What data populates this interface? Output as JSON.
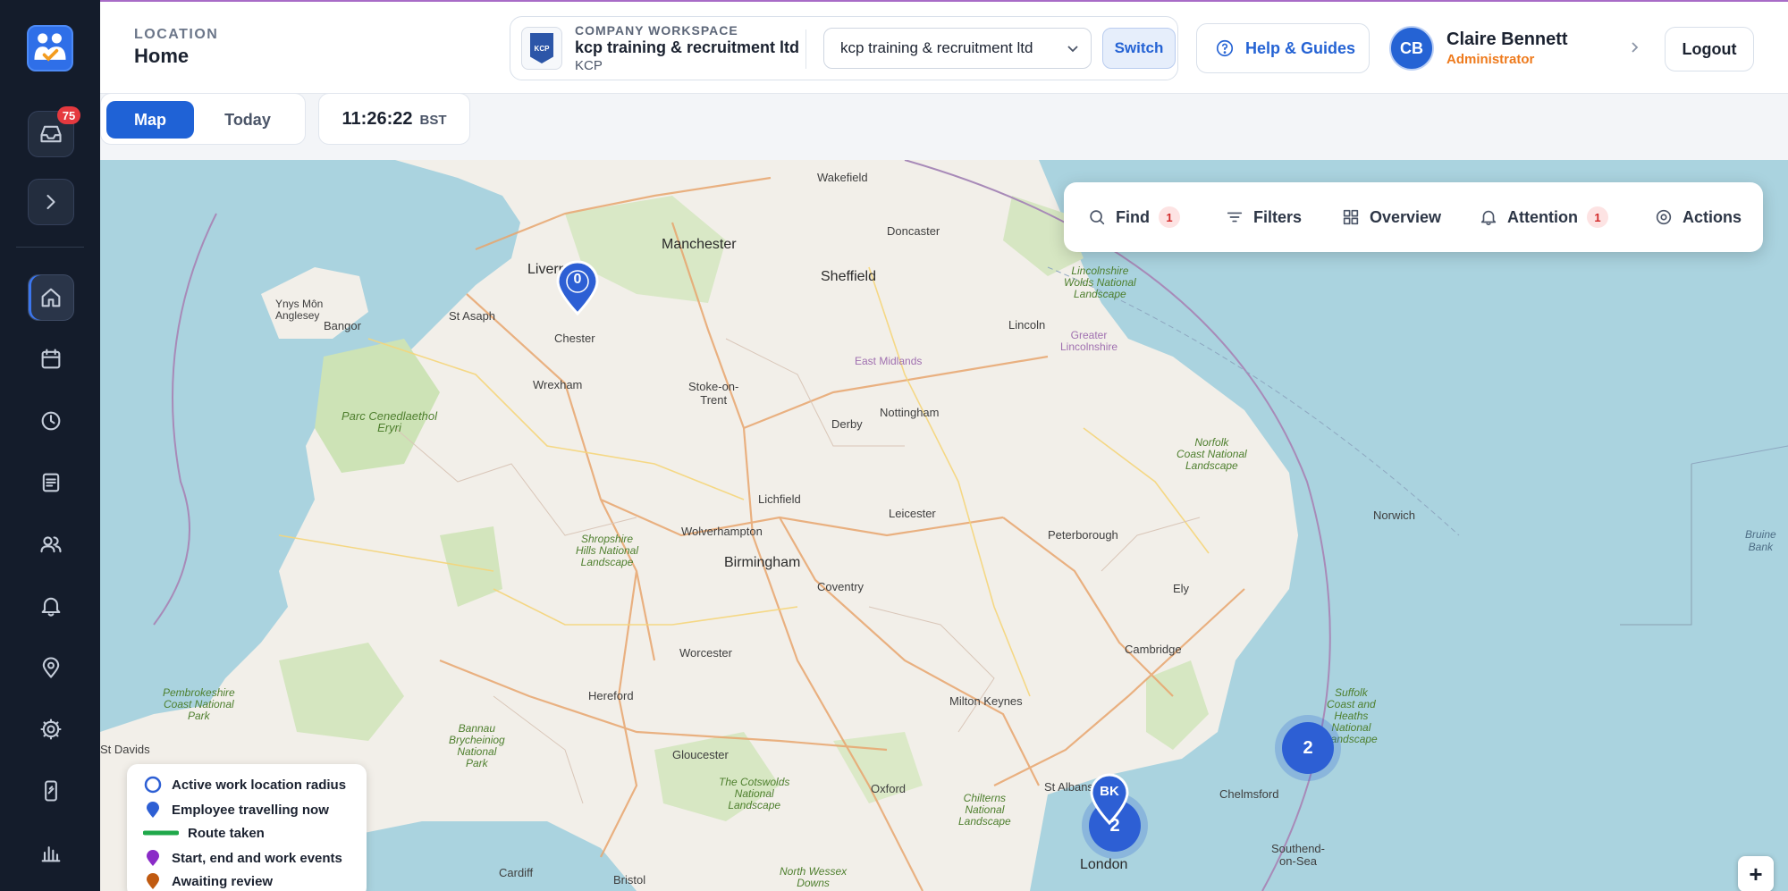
{
  "sidebar": {
    "inbox_badge": "75",
    "items": [
      {
        "name": "inbox",
        "icon": "inbox-icon"
      },
      {
        "name": "expand",
        "icon": "chevron-right-icon"
      },
      {
        "name": "home",
        "icon": "home-icon"
      },
      {
        "name": "calendar",
        "icon": "calendar-icon"
      },
      {
        "name": "clock",
        "icon": "clock-icon"
      },
      {
        "name": "documents",
        "icon": "document-icon"
      },
      {
        "name": "people",
        "icon": "users-icon"
      },
      {
        "name": "notifications",
        "icon": "bell-icon"
      },
      {
        "name": "locations",
        "icon": "location-pin-icon"
      },
      {
        "name": "settings",
        "icon": "gear-icon"
      },
      {
        "name": "device",
        "icon": "mobile-icon"
      },
      {
        "name": "reports",
        "icon": "bar-chart-icon"
      }
    ]
  },
  "header": {
    "location_label": "LOCATION",
    "location_title": "Home",
    "workspace": {
      "label": "COMPANY WORKSPACE",
      "name": "kcp training & recruitment ltd",
      "code": "KCP",
      "logo_text": "KCP",
      "selected": "kcp training & recruitment ltd",
      "switch_label": "Switch"
    },
    "help_label": "Help & Guides",
    "user": {
      "initials": "CB",
      "name": "Claire Bennett",
      "role": "Administrator"
    },
    "logout_label": "Logout"
  },
  "toolbar": {
    "map_label": "Map",
    "today_label": "Today",
    "time": "11:26:22",
    "timezone": "BST"
  },
  "actions": {
    "find_label": "Find",
    "find_count": "1",
    "filters_label": "Filters",
    "overview_label": "Overview",
    "attention_label": "Attention",
    "attention_count": "1",
    "actions_label": "Actions"
  },
  "map": {
    "markers": {
      "pin_liverpool": "0",
      "pin_london": "BK",
      "cluster_london": "2",
      "cluster_suffolk": "2"
    },
    "places": {
      "manchester": "Manchester",
      "sheffield": "Sheffield",
      "wakefield": "Wakefield",
      "doncaster": "Doncaster",
      "liverpool": "Liverpool",
      "chester": "Chester",
      "wrexham": "Wrexham",
      "bangor": "Bangor",
      "st_asaph": "St Asaph",
      "ynys_mon": "Ynys Môn\nAnglesey",
      "stoke": "Stoke-on-\nTrent",
      "derby": "Derby",
      "nottingham": "Nottingham",
      "lincoln": "Lincoln",
      "east_midlands": "East Midlands",
      "greater_lincolnshire": "Greater\nLincolnshire",
      "lincolnshire_wolds": "Lincolnshire\nWolds National\nLandscape",
      "norfolk_coast": "Norfolk\nCoast National\nLandscape",
      "norwich": "Norwich",
      "peterborough": "Peterborough",
      "leicester": "Leicester",
      "lichfield": "Lichfield",
      "wolverhampton": "Wolverhampton",
      "birmingham": "Birmingham",
      "coventry": "Coventry",
      "shropshire_hills": "Shropshire\nHills National\nLandscape",
      "parc_eryri": "Parc Cenedlaethol\nEryri",
      "ely": "Ely",
      "cambridge": "Cambridge",
      "milton_keynes": "Milton Keynes",
      "worcester": "Worcester",
      "hereford": "Hereford",
      "gloucester": "Gloucester",
      "oxford": "Oxford",
      "st_albans": "St Albans",
      "chelmsford": "Chelmsford",
      "southend": "Southend-\non-Sea",
      "london": "London",
      "cardiff": "Cardiff",
      "bristol": "Bristol",
      "st_davids": "St Davids",
      "cotswolds": "The Cotswolds\nNational\nLandscape",
      "chilterns": "Chilterns\nNational\nLandscape",
      "suffolk_coast": "Suffolk\nCoast and\nHeaths\nNational\nLandscape",
      "pembrokeshire": "Pembrokeshire\nCoast National\nPark",
      "bannau": "Bannau\nBrycheiniog\nNational\nPark",
      "north_wessex": "North Wessex\nDowns",
      "bruine_bank": "Bruine\nBank"
    }
  },
  "legend": {
    "items": [
      {
        "label": "Active work location radius",
        "color": "#2d5fd4"
      },
      {
        "label": "Employee travelling now",
        "color": "#2d5fd4"
      },
      {
        "label": "Route taken",
        "color": "#1fa84a"
      },
      {
        "label": "Start, end and work events",
        "color": "#8a2bc7"
      },
      {
        "label": "Awaiting review",
        "color": "#c05a10"
      }
    ]
  },
  "zoom_in_label": "+"
}
